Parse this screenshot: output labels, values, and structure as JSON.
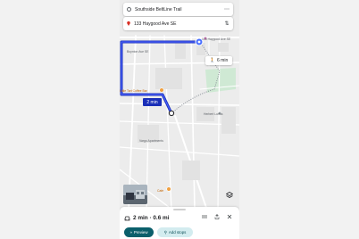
{
  "directions": {
    "origin": "Southside BeltLine Trail",
    "destination": "133 Haygood Ave SE"
  },
  "map": {
    "labels": {
      "dest_address": "133 Haygood Ave SE",
      "boynton": "Boynton Ave SE",
      "coffee": "Little Tart Coffee Bar",
      "herb_lourdes": "Herbert Lurfss",
      "ridge": "Ridge",
      "vargo": "Vargo Apartments",
      "cafe": "Cafe",
      "park_st": "Memorial Ave SE",
      "side_st_left": "Haygood Ave SE",
      "side_st_right": "Kirkwood"
    },
    "drive_time": "2 min",
    "walk_time": "6 min"
  },
  "bottom_sheet": {
    "summary": "2 min · 0.6 mi",
    "preview_label": "Preview",
    "add_stops_label": "Add stops"
  },
  "colors": {
    "route": "#1a2fb8",
    "preview_button": "#0b5f6b",
    "add_stops_button": "#d3ecef",
    "park": "#cfe9d4",
    "poi": "#c26401"
  }
}
